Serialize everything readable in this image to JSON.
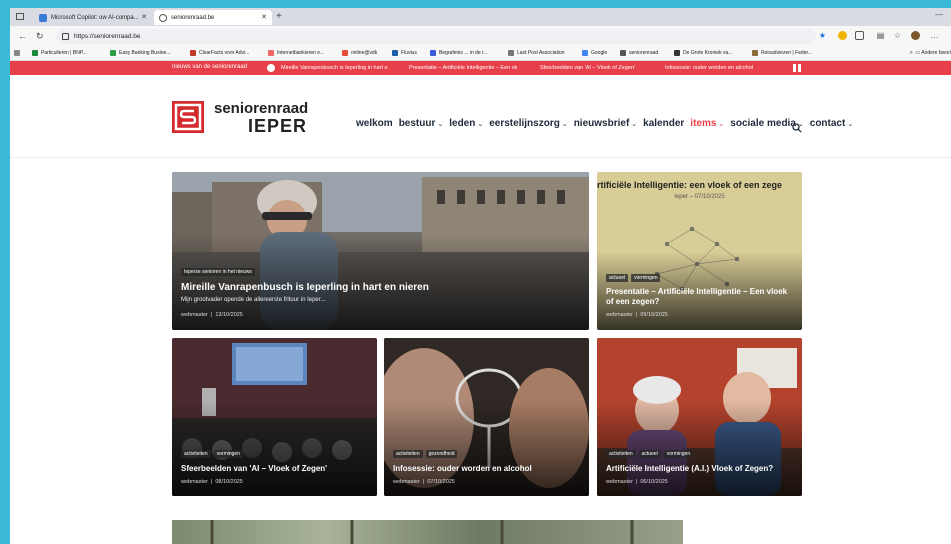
{
  "browser": {
    "tabs": [
      {
        "title": "Microsoft Copilot: uw AI-compa...",
        "active": false
      },
      {
        "title": "seniorenraad.be",
        "active": true
      }
    ],
    "url": "https://seniorenraad.be",
    "bookmarks": [
      "Particulieren | BNP...",
      "Easy Banking Busine...",
      "ClearFacts voor Advi...",
      "Internetbankieren e...",
      "online@vdk",
      "Fluvius",
      "Begrafenis ... in de r...",
      "Last Post Association",
      "Google",
      "seniorenraad",
      "De Grote Kroniek va...",
      "Reisadviezen | Feder..."
    ],
    "other_favorites": "Andere favori"
  },
  "ticker": {
    "label": "nieuws van de seniorenraad",
    "items": [
      "Mireille Vanrapenbusch is Ieperling in hart e",
      "Presentatie – Artificiële Intelligentie – Een vk",
      "Sfeerbeelden van 'AI – Vloek of Zegen'",
      "Infosessie: ouder worden en alcohol"
    ]
  },
  "site": {
    "logo_line1": "seniorenraad",
    "logo_line2": "IEPER",
    "nav": [
      {
        "label": "welkom",
        "chevron": false,
        "active": false
      },
      {
        "label": "bestuur",
        "chevron": true,
        "active": false
      },
      {
        "label": "leden",
        "chevron": true,
        "active": false
      },
      {
        "label": "eerstelijnszorg",
        "chevron": true,
        "active": false
      },
      {
        "label": "nieuwsbrief",
        "chevron": true,
        "active": false
      },
      {
        "label": "kalender",
        "chevron": false,
        "active": false
      },
      {
        "label": "items",
        "chevron": true,
        "active": true
      },
      {
        "label": "sociale media",
        "chevron": true,
        "active": false
      },
      {
        "label": "contact",
        "chevron": true,
        "active": false
      }
    ],
    "chevron_glyph": "⌄"
  },
  "posts": [
    {
      "tags": [
        "Ieperse senioren in het nieuws"
      ],
      "title": "Mireille Vanrapenbusch is Ieperling in hart en nieren",
      "excerpt": "Mijn grootvader opende de allereerste frituur in Ieper...",
      "author": "webmaster",
      "date": "13/10/2025"
    },
    {
      "tags": [
        "actueel",
        "vormingen"
      ],
      "title": "Presentatie – Artificiële Intelligentie – Een vloek of een zegen?",
      "image_heading": "rtificiële Intelligentie: een vloek of een zege",
      "image_sub": "Ieper – 07/10/2025",
      "author": "webmaster",
      "date": "09/10/2025"
    },
    {
      "tags": [
        "activiteiten",
        "vormingen"
      ],
      "title": "Sfeerbeelden van 'AI – Vloek of Zegen'",
      "author": "webmaster",
      "date": "08/10/2025"
    },
    {
      "tags": [
        "activiteiten",
        "gezondheid"
      ],
      "title": "Infosessie: ouder worden en alcohol",
      "author": "webmaster",
      "date": "07/10/2025"
    },
    {
      "tags": [
        "activiteiten",
        "actueel",
        "vormingen"
      ],
      "title": "Artificiële Intelligentie (A.I.) Vloek of Zegen?",
      "author": "webmaster",
      "date": "06/10/2025"
    }
  ]
}
